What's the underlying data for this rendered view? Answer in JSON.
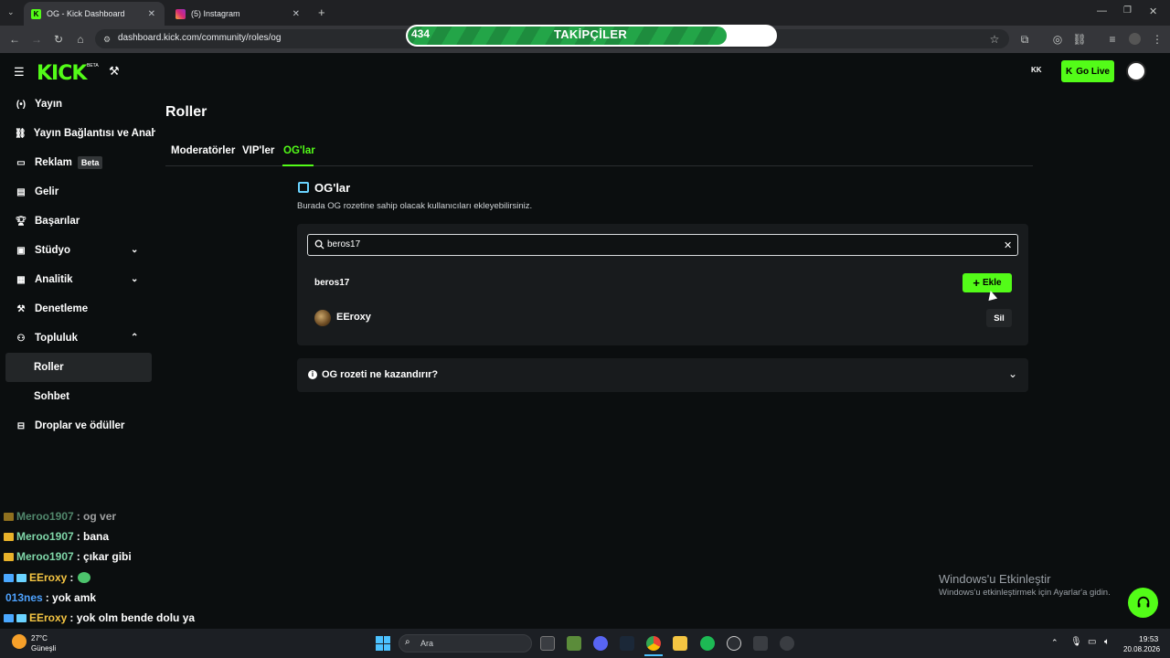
{
  "browser": {
    "tabs": [
      {
        "label": "OG - Kick Dashboard",
        "active": true
      },
      {
        "label": "(5) Instagram",
        "active": false
      }
    ],
    "url": "dashboard.kick.com/community/roles/og"
  },
  "follower_goal": {
    "current": "434",
    "title": "TAKİPÇİLER",
    "goal": "500",
    "progress_fraction": 0.868
  },
  "header": {
    "logo": "KICK",
    "logo_badge": "BETA",
    "go_live": "Go Live"
  },
  "sidebar": {
    "items": [
      {
        "label": "Yayın",
        "icon": "broadcast-icon"
      },
      {
        "label": "Yayın Bağlantısı ve Anahtarı",
        "icon": "link-icon"
      },
      {
        "label": "Reklam",
        "icon": "ad-icon",
        "badge": "Beta"
      },
      {
        "label": "Gelir",
        "icon": "revenue-icon"
      },
      {
        "label": "Başarılar",
        "icon": "trophy-icon"
      },
      {
        "label": "Stüdyo",
        "icon": "studio-icon"
      },
      {
        "label": "Analitik",
        "icon": "analytics-icon"
      },
      {
        "label": "Denetleme",
        "icon": "hammer-icon"
      },
      {
        "label": "Topluluk",
        "icon": "community-icon"
      },
      {
        "label": "Roller"
      },
      {
        "label": "Sohbet"
      },
      {
        "label": "Droplar ve ödüller",
        "icon": "drops-icon"
      }
    ]
  },
  "main": {
    "title": "Roller",
    "tabs": [
      {
        "label": "Moderatörler"
      },
      {
        "label": "VIP'ler"
      },
      {
        "label": "OG'lar",
        "active": true
      }
    ],
    "section_title": "OG'lar",
    "section_desc": "Burada OG rozetine sahip olacak kullanıcıları ekleyebilirsiniz.",
    "search_value": "beros17",
    "search_result": "beros17",
    "add_label": "Ekle",
    "members": [
      {
        "name": "EEroxy",
        "action": "Sil"
      }
    ],
    "faq_title": "OG rozeti ne kazandırır?"
  },
  "chat": [
    {
      "user": "Meroo1907",
      "text": ": og ver",
      "color": "#7fd6a8"
    },
    {
      "user": "Meroo1907",
      "text": ": bana",
      "color": "#7fd6a8"
    },
    {
      "user": "Meroo1907",
      "text": ": çıkar gibi",
      "color": "#7fd6a8"
    },
    {
      "user": "EEroxy",
      "text": ":",
      "color": "#f5c542"
    },
    {
      "user": "013nes",
      "text": ": yok amk",
      "color": "#4ea3ff"
    },
    {
      "user": "EEroxy",
      "text": ": yok olm bende dolu ya",
      "color": "#f5c542"
    }
  ],
  "watermark": {
    "line1": "Windows'u Etkinleştir",
    "line2": "Windows'u etkinleştirmek için Ayarlar'a gidin."
  },
  "taskbar": {
    "temp": "27°C",
    "weather": "Güneşli",
    "search": "Ara",
    "time": "19:53",
    "date": "20.08.2026"
  }
}
